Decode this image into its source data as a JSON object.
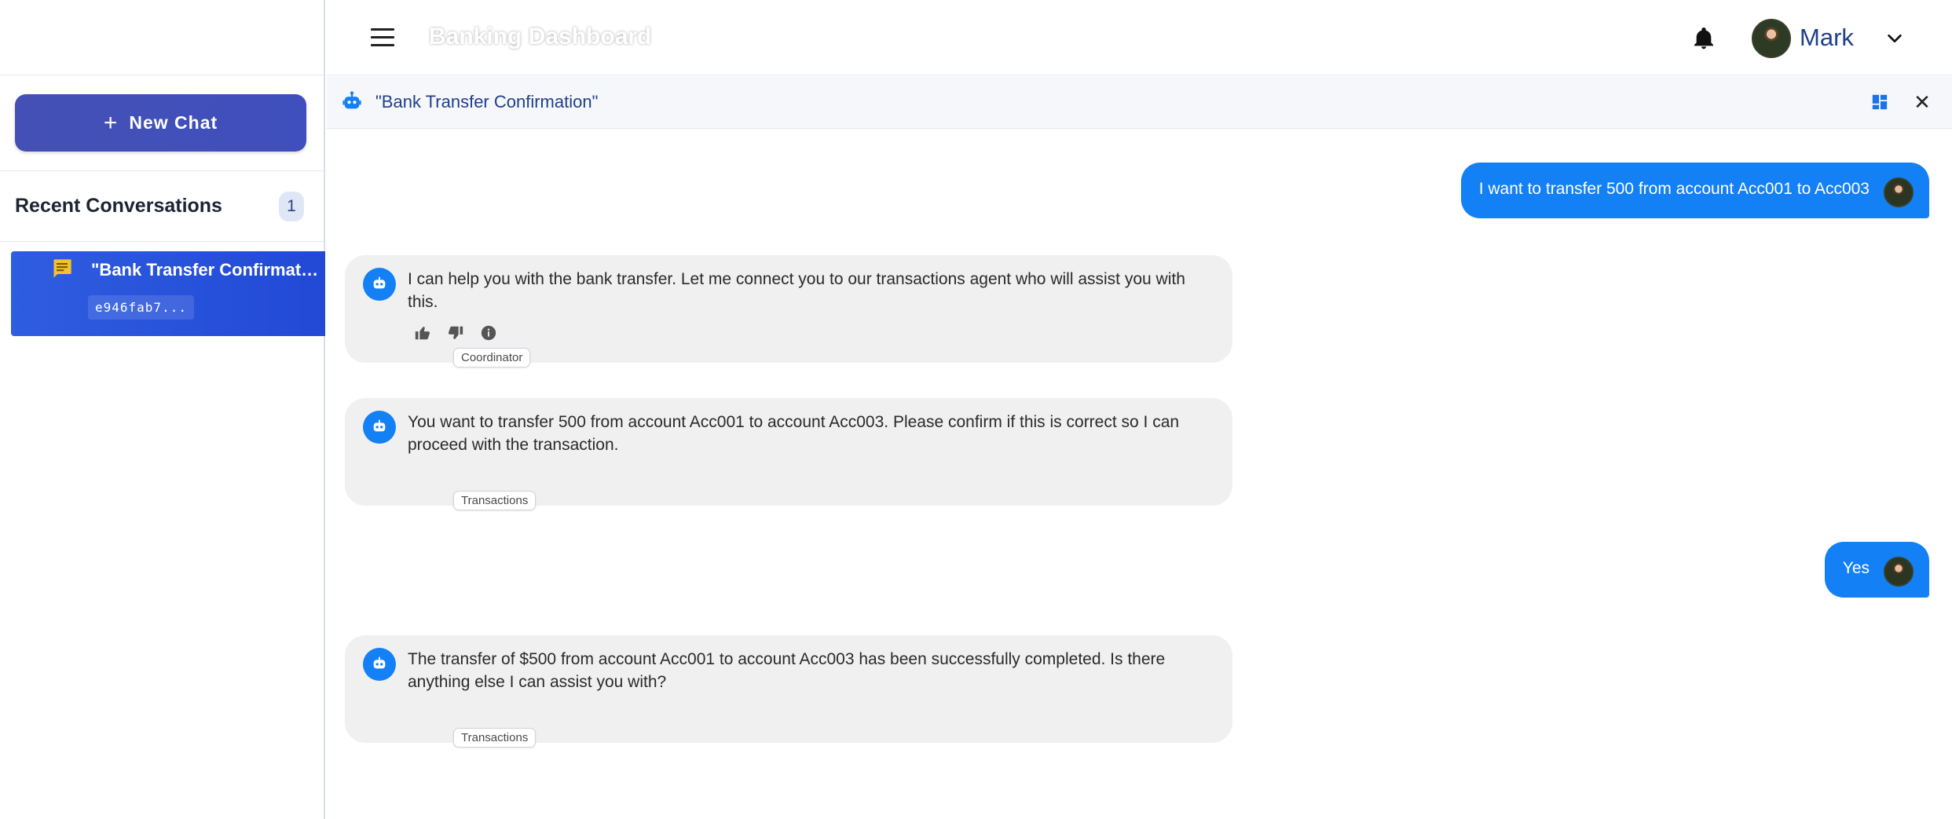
{
  "header": {
    "app_title": "Banking Dashboard",
    "user_name": "Mark"
  },
  "sidebar": {
    "new_chat_label": "New Chat",
    "recent_title": "Recent Conversations",
    "recent_count": "1",
    "conversations": [
      {
        "title": "\"Bank Transfer Confirmation\"",
        "id": "e946fab7..."
      }
    ]
  },
  "chat": {
    "title": "\"Bank Transfer Confirmation\"",
    "messages": [
      {
        "role": "user",
        "text": "I want to transfer 500 from account Acc001 to Acc003"
      },
      {
        "role": "bot",
        "text": "I can help you with the bank transfer. Let me connect you to our transactions agent who will assist you with this.",
        "agent": "Coordinator"
      },
      {
        "role": "bot",
        "text": "You want to transfer 500 from account Acc001 to account Acc003. Please confirm if this is correct so I can proceed with the transaction.",
        "agent": "Transactions"
      },
      {
        "role": "user",
        "text": "Yes"
      },
      {
        "role": "bot",
        "text": "The transfer of $500 from account Acc001 to account Acc003 has been successfully completed. Is there anything else I can assist you with?",
        "agent": "Transactions"
      }
    ]
  },
  "colors": {
    "accent": "#1380f5",
    "new_chat": "#4450b5",
    "active_conversation": "#2f5de0",
    "conversation_icon": "#f2c230"
  },
  "icons": {
    "menu": "hamburger-icon",
    "notifications": "bell-icon",
    "dropdown": "chevron-down-icon",
    "bot": "robot-icon",
    "layout": "dashboard-icon",
    "close": "close-icon",
    "conversation": "chat-bubble-icon",
    "like": "thumbs-up-icon",
    "dislike": "thumbs-down-icon",
    "info": "info-icon"
  }
}
